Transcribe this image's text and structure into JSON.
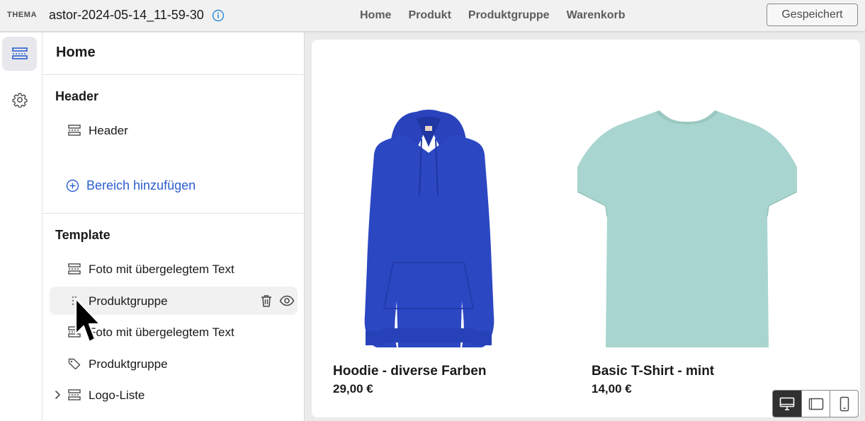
{
  "topbar": {
    "theme_label": "THEMA",
    "theme_name": "astor-2024-05-14_11-59-30",
    "nav": [
      "Home",
      "Produkt",
      "Produktgruppe",
      "Warenkorb"
    ],
    "save_label": "Gespeichert"
  },
  "rail": {
    "items": [
      {
        "icon": "sections-icon",
        "active": true
      },
      {
        "icon": "gear-icon",
        "active": false
      }
    ]
  },
  "sidebar": {
    "title": "Home",
    "header_section": {
      "heading": "Header",
      "items": [
        {
          "label": "Header",
          "icon": "section-icon"
        }
      ]
    },
    "add_section_label": "Bereich hinzufügen",
    "template_section": {
      "heading": "Template",
      "items": [
        {
          "label": "Foto mit übergelegtem Text",
          "icon": "section-icon"
        },
        {
          "label": "Produktgruppe",
          "icon": "drag-handle-icon",
          "hovered": true
        },
        {
          "label": "Foto mit übergelegtem Text",
          "icon": "section-icon"
        },
        {
          "label": "Produktgruppe",
          "icon": "tag-icon"
        },
        {
          "label": "Logo-Liste",
          "icon": "section-icon",
          "collapsible": true
        }
      ]
    }
  },
  "preview": {
    "products": [
      {
        "name": "Hoodie - diverse Farben",
        "price": "29,00 €",
        "image": "blue-hoodie",
        "color": "#2c47c2"
      },
      {
        "name": "Basic T-Shirt - mint",
        "price": "14,00 €",
        "image": "mint-tshirt",
        "color": "#a8d5cf"
      }
    ]
  },
  "device_switcher": [
    "desktop-icon",
    "tablet-icon",
    "mobile-icon"
  ],
  "colors": {
    "accent": "#2c5ecf",
    "topbar": "#f1f1f1",
    "canvas": "#ebebeb"
  }
}
